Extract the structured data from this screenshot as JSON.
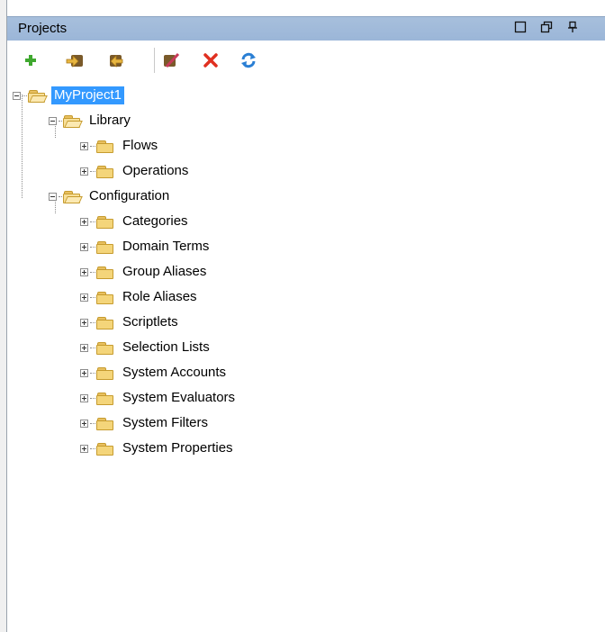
{
  "panel": {
    "title": "Projects",
    "controls": {
      "maximize": "☐",
      "restore": "⧉",
      "pin": "⊥"
    }
  },
  "toolbar": {
    "buttons": [
      {
        "name": "new-button",
        "icon": "plus-icon"
      },
      {
        "name": "import-button",
        "icon": "import-icon"
      },
      {
        "name": "export-button",
        "icon": "export-icon"
      },
      {
        "name": "edit-button",
        "icon": "edit-icon"
      },
      {
        "name": "delete-button",
        "icon": "delete-icon"
      },
      {
        "name": "refresh-button",
        "icon": "refresh-icon"
      }
    ]
  },
  "tree": {
    "project": "MyProject1",
    "library": {
      "label": "Library",
      "children": [
        "Flows",
        "Operations"
      ]
    },
    "configuration": {
      "label": "Configuration",
      "children": [
        "Categories",
        "Domain Terms",
        "Group Aliases",
        "Role Aliases",
        "Scriptlets",
        "Selection Lists",
        "System Accounts",
        "System Evaluators",
        "System Filters",
        "System Properties"
      ]
    }
  },
  "colors": {
    "titlebar": "#a7bfdc",
    "selection": "#3399ff",
    "folder": "#f4d57a"
  }
}
